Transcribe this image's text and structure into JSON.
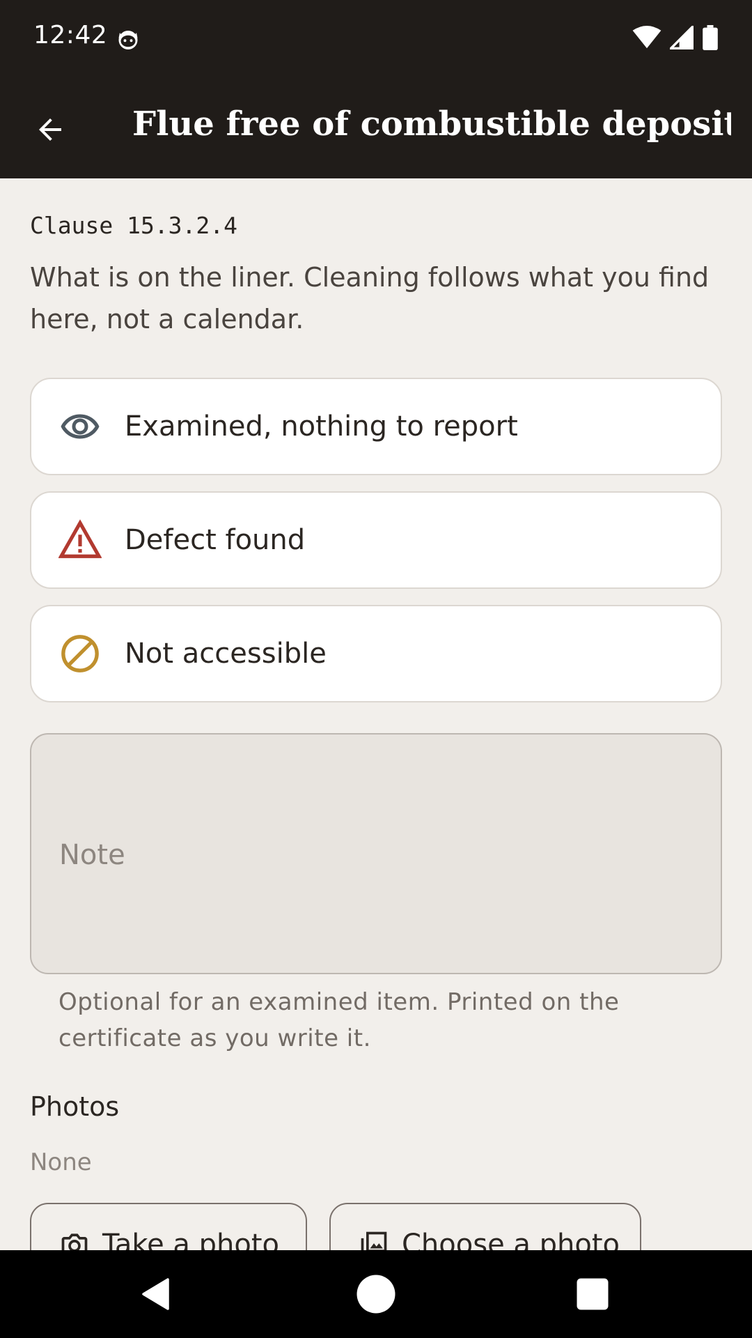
{
  "status_bar": {
    "time": "12:42"
  },
  "app_bar": {
    "title": "Flue free of combustible deposits"
  },
  "clause": "Clause 15.3.2.4",
  "description": "What is on the liner. Cleaning follows what you find here, not a calendar.",
  "options": [
    {
      "label": "Examined, nothing to report",
      "icon": "eye-icon",
      "color": "#4f5a63"
    },
    {
      "label": "Defect found",
      "icon": "warning-icon",
      "color": "#b23a30"
    },
    {
      "label": "Not accessible",
      "icon": "no-entry-icon",
      "color": "#c0902e"
    }
  ],
  "note": {
    "placeholder": "Note",
    "helper": "Optional for an examined item. Printed on the certificate as you write it."
  },
  "photos": {
    "title": "Photos",
    "status": "None",
    "take_label": "Take a photo",
    "choose_label": "Choose a photo"
  }
}
